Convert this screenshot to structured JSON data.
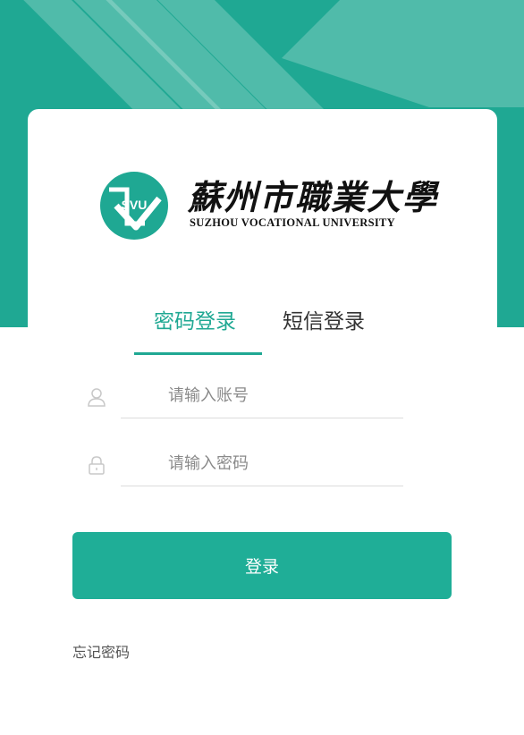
{
  "brand": {
    "logo_badge_text": "SVU",
    "name_cn": "蘇州市職業大學",
    "name_en": "SUZHOU VOCATIONAL UNIVERSITY"
  },
  "tabs": [
    {
      "label": "密码登录",
      "active": true
    },
    {
      "label": "短信登录",
      "active": false
    }
  ],
  "form": {
    "account_placeholder": "请输入账号",
    "account_value": "",
    "password_placeholder": "请输入密码",
    "password_value": ""
  },
  "login_button_label": "登录",
  "forgot_password_label": "忘记密码",
  "colors": {
    "accent": "#1fa893",
    "button": "#1fae97",
    "text_dark": "#333333"
  }
}
